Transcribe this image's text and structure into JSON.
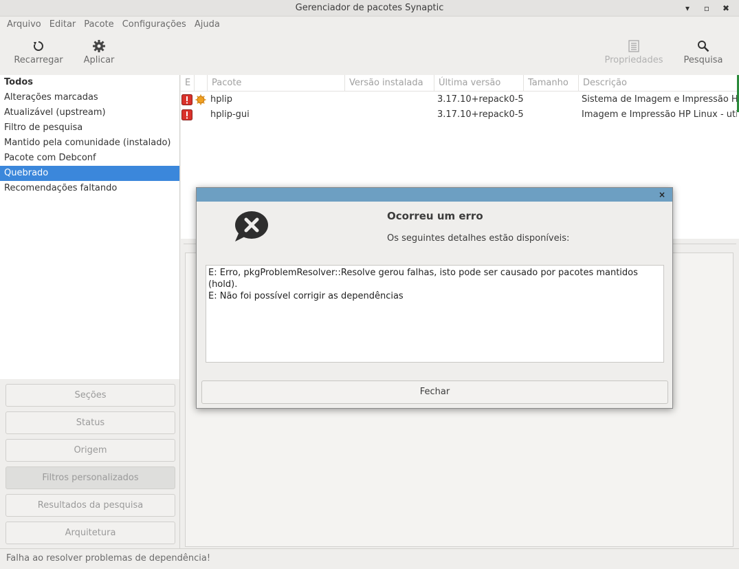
{
  "window": {
    "title": "Gerenciador de pacotes Synaptic",
    "minimize": "▾",
    "maximize": "▫",
    "close": "✖"
  },
  "menu": [
    "Arquivo",
    "Editar",
    "Pacote",
    "Configurações",
    "Ajuda"
  ],
  "toolbar": {
    "reload": "Recarregar",
    "apply": "Aplicar",
    "properties": "Propriedades",
    "search": "Pesquisa"
  },
  "filters": [
    "Todos",
    "Alterações marcadas",
    "Atualizável (upstream)",
    "Filtro de pesquisa",
    "Mantido pela comunidade (instalado)",
    "Pacote com Debconf",
    "Quebrado",
    "Recomendações faltando"
  ],
  "side_buttons": [
    "Seções",
    "Status",
    "Origem",
    "Filtros personalizados",
    "Resultados da pesquisa",
    "Arquitetura"
  ],
  "table": {
    "headers": [
      "E",
      "",
      "Pacote",
      "Versão instalada",
      "Última versão",
      "Tamanho",
      "Descrição"
    ],
    "rows": [
      {
        "name": "hplip",
        "installed": "",
        "latest": "3.17.10+repack0-5",
        "size": "",
        "description": "Sistema de Imagem e Impressão HP Linux"
      },
      {
        "name": "hplip-gui",
        "installed": "",
        "latest": "3.17.10+repack0-5",
        "size": "",
        "description": "Imagem e Impressão HP Linux - utilitário"
      }
    ]
  },
  "status": "Falha ao resolver problemas de dependência!",
  "dialog": {
    "close": "×",
    "heading": "Ocorreu um erro",
    "subheading": "Os seguintes detalhes estão disponíveis:",
    "lines": [
      "E: Erro, pkgProblemResolver::Resolve gerou falhas, isto pode ser causado por pacotes mantidos (hold).",
      "E: Não foi possível corrigir as dependências"
    ],
    "button": "Fechar"
  },
  "colors": {
    "selection": "#3b87db",
    "dialog_title": "#6d9fc2",
    "broken": "#d9322b"
  }
}
